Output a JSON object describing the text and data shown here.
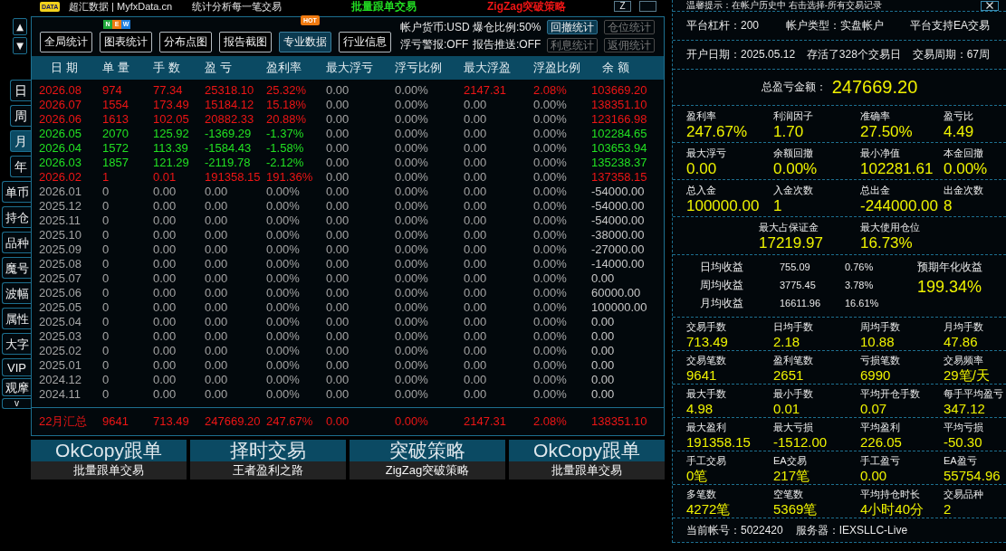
{
  "nav": {
    "scroll": [
      "▲",
      "▼"
    ],
    "periods": [
      {
        "label": "日",
        "selected": false
      },
      {
        "label": "周",
        "selected": false
      },
      {
        "label": "月",
        "selected": true
      },
      {
        "label": "年",
        "selected": false
      }
    ],
    "views": [
      "单币",
      "持仓",
      "品种",
      "魔号",
      "波幅",
      "属性",
      "大字"
    ],
    "extras": [
      "VIP",
      "观摩"
    ],
    "more": "v"
  },
  "top_strip": {
    "logo": "DATA",
    "site": "超汇数据 | MyfxData.cn",
    "tagline": "统计分析每一笔交易",
    "promos": [
      {
        "text": "批量跟单交易",
        "color": "#22dd22"
      },
      {
        "text": "ZigZag突破策略",
        "color": "#ee1515"
      }
    ],
    "buttons": [
      "Z"
    ]
  },
  "toolbar": {
    "buttons": [
      {
        "label": "全局统计",
        "selected": false
      },
      {
        "label": "图表统计",
        "selected": false,
        "badge": {
          "kind": "new",
          "letters": [
            {
              "text": "N",
              "color": "#1fa83a"
            },
            {
              "text": "E",
              "color": "#f07a10"
            },
            {
              "text": "W",
              "color": "#1e7fe0"
            }
          ]
        }
      },
      {
        "label": "分布点图",
        "selected": false
      },
      {
        "label": "报告截图",
        "selected": false
      },
      {
        "label": "专业数据",
        "selected": true,
        "badge": {
          "kind": "hot",
          "text": "HOT"
        }
      },
      {
        "label": "行业信息",
        "selected": false
      }
    ],
    "settings": [
      "帐户货币:USD",
      "爆仓比例:50%",
      "浮亏警报:OFF",
      "报告推送:OFF"
    ],
    "side_buttons": [
      {
        "label": "回撤统计",
        "disabled": false
      },
      {
        "label": "仓位统计",
        "disabled": true
      },
      {
        "label": "利息统计",
        "disabled": true
      },
      {
        "label": "返佣统计",
        "disabled": true
      }
    ]
  },
  "table": {
    "columns": [
      "日 期",
      "单 量",
      "手 数",
      "盈 亏",
      "盈利率",
      "最大浮亏",
      "浮亏比例",
      "最大浮盈",
      "浮盈比例",
      "余 额"
    ],
    "rows": [
      {
        "cells": [
          {
            "text": "2026.08",
            "color": "#ee1515"
          },
          {
            "text": "974",
            "color": "#ee1515"
          },
          {
            "text": "77.34",
            "color": "#ee1515"
          },
          {
            "text": "25318.10",
            "color": "#ee1515"
          },
          {
            "text": "25.32%",
            "color": "#ee1515"
          },
          {
            "text": "0.00",
            "color": "#a4a4a4"
          },
          {
            "text": "0.00%",
            "color": "#a4a4a4"
          },
          {
            "text": "2147.31",
            "color": "#ee1515"
          },
          {
            "text": "2.08%",
            "color": "#ee1515"
          },
          {
            "text": "103669.20",
            "color": "#ee1515"
          }
        ]
      },
      {
        "cells": [
          {
            "text": "2026.07",
            "color": "#ee1515"
          },
          {
            "text": "1554",
            "color": "#ee1515"
          },
          {
            "text": "173.49",
            "color": "#ee1515"
          },
          {
            "text": "15184.12",
            "color": "#ee1515"
          },
          {
            "text": "15.18%",
            "color": "#ee1515"
          },
          {
            "text": "0.00",
            "color": "#a4a4a4"
          },
          {
            "text": "0.00%",
            "color": "#a4a4a4"
          },
          {
            "text": "0.00",
            "color": "#a4a4a4"
          },
          {
            "text": "0.00%",
            "color": "#a4a4a4"
          },
          {
            "text": "138351.10",
            "color": "#ee1515"
          }
        ]
      },
      {
        "cells": [
          {
            "text": "2026.06",
            "color": "#ee1515"
          },
          {
            "text": "1613",
            "color": "#ee1515"
          },
          {
            "text": "102.05",
            "color": "#ee1515"
          },
          {
            "text": "20882.33",
            "color": "#ee1515"
          },
          {
            "text": "20.88%",
            "color": "#ee1515"
          },
          {
            "text": "0.00",
            "color": "#a4a4a4"
          },
          {
            "text": "0.00%",
            "color": "#a4a4a4"
          },
          {
            "text": "0.00",
            "color": "#a4a4a4"
          },
          {
            "text": "0.00%",
            "color": "#a4a4a4"
          },
          {
            "text": "123166.98",
            "color": "#ee1515"
          }
        ]
      },
      {
        "cells": [
          {
            "text": "2026.05",
            "color": "#22e022"
          },
          {
            "text": "2070",
            "color": "#22e022"
          },
          {
            "text": "125.92",
            "color": "#22e022"
          },
          {
            "text": "-1369.29",
            "color": "#22e022"
          },
          {
            "text": "-1.37%",
            "color": "#22e022"
          },
          {
            "text": "0.00",
            "color": "#a4a4a4"
          },
          {
            "text": "0.00%",
            "color": "#a4a4a4"
          },
          {
            "text": "0.00",
            "color": "#a4a4a4"
          },
          {
            "text": "0.00%",
            "color": "#a4a4a4"
          },
          {
            "text": "102284.65",
            "color": "#22e022"
          }
        ]
      },
      {
        "cells": [
          {
            "text": "2026.04",
            "color": "#22e022"
          },
          {
            "text": "1572",
            "color": "#22e022"
          },
          {
            "text": "113.39",
            "color": "#22e022"
          },
          {
            "text": "-1584.43",
            "color": "#22e022"
          },
          {
            "text": "-1.58%",
            "color": "#22e022"
          },
          {
            "text": "0.00",
            "color": "#a4a4a4"
          },
          {
            "text": "0.00%",
            "color": "#a4a4a4"
          },
          {
            "text": "0.00",
            "color": "#a4a4a4"
          },
          {
            "text": "0.00%",
            "color": "#a4a4a4"
          },
          {
            "text": "103653.94",
            "color": "#22e022"
          }
        ]
      },
      {
        "cells": [
          {
            "text": "2026.03",
            "color": "#22e022"
          },
          {
            "text": "1857",
            "color": "#22e022"
          },
          {
            "text": "121.29",
            "color": "#22e022"
          },
          {
            "text": "-2119.78",
            "color": "#22e022"
          },
          {
            "text": "-2.12%",
            "color": "#22e022"
          },
          {
            "text": "0.00",
            "color": "#a4a4a4"
          },
          {
            "text": "0.00%",
            "color": "#a4a4a4"
          },
          {
            "text": "0.00",
            "color": "#a4a4a4"
          },
          {
            "text": "0.00%",
            "color": "#a4a4a4"
          },
          {
            "text": "135238.37",
            "color": "#22e022"
          }
        ]
      },
      {
        "cells": [
          {
            "text": "2026.02",
            "color": "#ee1515"
          },
          {
            "text": "1",
            "color": "#ee1515"
          },
          {
            "text": "0.01",
            "color": "#ee1515"
          },
          {
            "text": "191358.15",
            "color": "#ee1515"
          },
          {
            "text": "191.36%",
            "color": "#ee1515"
          },
          {
            "text": "0.00",
            "color": "#a4a4a4"
          },
          {
            "text": "0.00%",
            "color": "#a4a4a4"
          },
          {
            "text": "0.00",
            "color": "#a4a4a4"
          },
          {
            "text": "0.00%",
            "color": "#a4a4a4"
          },
          {
            "text": "137358.15",
            "color": "#ee1515"
          }
        ]
      },
      {
        "cells": [
          {
            "text": "2026.01",
            "color": "#a4a4a4"
          },
          {
            "text": "0",
            "color": "#a4a4a4"
          },
          {
            "text": "0.00",
            "color": "#a4a4a4"
          },
          {
            "text": "0.00",
            "color": "#a4a4a4"
          },
          {
            "text": "0.00%",
            "color": "#a4a4a4"
          },
          {
            "text": "0.00",
            "color": "#a4a4a4"
          },
          {
            "text": "0.00%",
            "color": "#a4a4a4"
          },
          {
            "text": "0.00",
            "color": "#a4a4a4"
          },
          {
            "text": "0.00%",
            "color": "#a4a4a4"
          },
          {
            "text": "-54000.00",
            "color": "#c6c6c6"
          }
        ]
      },
      {
        "cells": [
          {
            "text": "2025.12",
            "color": "#a4a4a4"
          },
          {
            "text": "0",
            "color": "#a4a4a4"
          },
          {
            "text": "0.00",
            "color": "#a4a4a4"
          },
          {
            "text": "0.00",
            "color": "#a4a4a4"
          },
          {
            "text": "0.00%",
            "color": "#a4a4a4"
          },
          {
            "text": "0.00",
            "color": "#a4a4a4"
          },
          {
            "text": "0.00%",
            "color": "#a4a4a4"
          },
          {
            "text": "0.00",
            "color": "#a4a4a4"
          },
          {
            "text": "0.00%",
            "color": "#a4a4a4"
          },
          {
            "text": "-54000.00",
            "color": "#c6c6c6"
          }
        ]
      },
      {
        "cells": [
          {
            "text": "2025.11",
            "color": "#a4a4a4"
          },
          {
            "text": "0",
            "color": "#a4a4a4"
          },
          {
            "text": "0.00",
            "color": "#a4a4a4"
          },
          {
            "text": "0.00",
            "color": "#a4a4a4"
          },
          {
            "text": "0.00%",
            "color": "#a4a4a4"
          },
          {
            "text": "0.00",
            "color": "#a4a4a4"
          },
          {
            "text": "0.00%",
            "color": "#a4a4a4"
          },
          {
            "text": "0.00",
            "color": "#a4a4a4"
          },
          {
            "text": "0.00%",
            "color": "#a4a4a4"
          },
          {
            "text": "-54000.00",
            "color": "#c6c6c6"
          }
        ]
      },
      {
        "cells": [
          {
            "text": "2025.10",
            "color": "#a4a4a4"
          },
          {
            "text": "0",
            "color": "#a4a4a4"
          },
          {
            "text": "0.00",
            "color": "#a4a4a4"
          },
          {
            "text": "0.00",
            "color": "#a4a4a4"
          },
          {
            "text": "0.00%",
            "color": "#a4a4a4"
          },
          {
            "text": "0.00",
            "color": "#a4a4a4"
          },
          {
            "text": "0.00%",
            "color": "#a4a4a4"
          },
          {
            "text": "0.00",
            "color": "#a4a4a4"
          },
          {
            "text": "0.00%",
            "color": "#a4a4a4"
          },
          {
            "text": "-38000.00",
            "color": "#c6c6c6"
          }
        ]
      },
      {
        "cells": [
          {
            "text": "2025.09",
            "color": "#a4a4a4"
          },
          {
            "text": "0",
            "color": "#a4a4a4"
          },
          {
            "text": "0.00",
            "color": "#a4a4a4"
          },
          {
            "text": "0.00",
            "color": "#a4a4a4"
          },
          {
            "text": "0.00%",
            "color": "#a4a4a4"
          },
          {
            "text": "0.00",
            "color": "#a4a4a4"
          },
          {
            "text": "0.00%",
            "color": "#a4a4a4"
          },
          {
            "text": "0.00",
            "color": "#a4a4a4"
          },
          {
            "text": "0.00%",
            "color": "#a4a4a4"
          },
          {
            "text": "-27000.00",
            "color": "#c6c6c6"
          }
        ]
      },
      {
        "cells": [
          {
            "text": "2025.08",
            "color": "#a4a4a4"
          },
          {
            "text": "0",
            "color": "#a4a4a4"
          },
          {
            "text": "0.00",
            "color": "#a4a4a4"
          },
          {
            "text": "0.00",
            "color": "#a4a4a4"
          },
          {
            "text": "0.00%",
            "color": "#a4a4a4"
          },
          {
            "text": "0.00",
            "color": "#a4a4a4"
          },
          {
            "text": "0.00%",
            "color": "#a4a4a4"
          },
          {
            "text": "0.00",
            "color": "#a4a4a4"
          },
          {
            "text": "0.00%",
            "color": "#a4a4a4"
          },
          {
            "text": "-14000.00",
            "color": "#c6c6c6"
          }
        ]
      },
      {
        "cells": [
          {
            "text": "2025.07",
            "color": "#a4a4a4"
          },
          {
            "text": "0",
            "color": "#a4a4a4"
          },
          {
            "text": "0.00",
            "color": "#a4a4a4"
          },
          {
            "text": "0.00",
            "color": "#a4a4a4"
          },
          {
            "text": "0.00%",
            "color": "#a4a4a4"
          },
          {
            "text": "0.00",
            "color": "#a4a4a4"
          },
          {
            "text": "0.00%",
            "color": "#a4a4a4"
          },
          {
            "text": "0.00",
            "color": "#a4a4a4"
          },
          {
            "text": "0.00%",
            "color": "#a4a4a4"
          },
          {
            "text": "0.00",
            "color": "#c6c6c6"
          }
        ]
      },
      {
        "cells": [
          {
            "text": "2025.06",
            "color": "#a4a4a4"
          },
          {
            "text": "0",
            "color": "#a4a4a4"
          },
          {
            "text": "0.00",
            "color": "#a4a4a4"
          },
          {
            "text": "0.00",
            "color": "#a4a4a4"
          },
          {
            "text": "0.00%",
            "color": "#a4a4a4"
          },
          {
            "text": "0.00",
            "color": "#a4a4a4"
          },
          {
            "text": "0.00%",
            "color": "#a4a4a4"
          },
          {
            "text": "0.00",
            "color": "#a4a4a4"
          },
          {
            "text": "0.00%",
            "color": "#a4a4a4"
          },
          {
            "text": "60000.00",
            "color": "#c6c6c6"
          }
        ]
      },
      {
        "cells": [
          {
            "text": "2025.05",
            "color": "#a4a4a4"
          },
          {
            "text": "0",
            "color": "#a4a4a4"
          },
          {
            "text": "0.00",
            "color": "#a4a4a4"
          },
          {
            "text": "0.00",
            "color": "#a4a4a4"
          },
          {
            "text": "0.00%",
            "color": "#a4a4a4"
          },
          {
            "text": "0.00",
            "color": "#a4a4a4"
          },
          {
            "text": "0.00%",
            "color": "#a4a4a4"
          },
          {
            "text": "0.00",
            "color": "#a4a4a4"
          },
          {
            "text": "0.00%",
            "color": "#a4a4a4"
          },
          {
            "text": "100000.00",
            "color": "#c6c6c6"
          }
        ]
      },
      {
        "cells": [
          {
            "text": "2025.04",
            "color": "#a4a4a4"
          },
          {
            "text": "0",
            "color": "#a4a4a4"
          },
          {
            "text": "0.00",
            "color": "#a4a4a4"
          },
          {
            "text": "0.00",
            "color": "#a4a4a4"
          },
          {
            "text": "0.00%",
            "color": "#a4a4a4"
          },
          {
            "text": "0.00",
            "color": "#a4a4a4"
          },
          {
            "text": "0.00%",
            "color": "#a4a4a4"
          },
          {
            "text": "0.00",
            "color": "#a4a4a4"
          },
          {
            "text": "0.00%",
            "color": "#a4a4a4"
          },
          {
            "text": "0.00",
            "color": "#c6c6c6"
          }
        ]
      },
      {
        "cells": [
          {
            "text": "2025.03",
            "color": "#a4a4a4"
          },
          {
            "text": "0",
            "color": "#a4a4a4"
          },
          {
            "text": "0.00",
            "color": "#a4a4a4"
          },
          {
            "text": "0.00",
            "color": "#a4a4a4"
          },
          {
            "text": "0.00%",
            "color": "#a4a4a4"
          },
          {
            "text": "0.00",
            "color": "#a4a4a4"
          },
          {
            "text": "0.00%",
            "color": "#a4a4a4"
          },
          {
            "text": "0.00",
            "color": "#a4a4a4"
          },
          {
            "text": "0.00%",
            "color": "#a4a4a4"
          },
          {
            "text": "0.00",
            "color": "#c6c6c6"
          }
        ]
      },
      {
        "cells": [
          {
            "text": "2025.02",
            "color": "#a4a4a4"
          },
          {
            "text": "0",
            "color": "#a4a4a4"
          },
          {
            "text": "0.00",
            "color": "#a4a4a4"
          },
          {
            "text": "0.00",
            "color": "#a4a4a4"
          },
          {
            "text": "0.00%",
            "color": "#a4a4a4"
          },
          {
            "text": "0.00",
            "color": "#a4a4a4"
          },
          {
            "text": "0.00%",
            "color": "#a4a4a4"
          },
          {
            "text": "0.00",
            "color": "#a4a4a4"
          },
          {
            "text": "0.00%",
            "color": "#a4a4a4"
          },
          {
            "text": "0.00",
            "color": "#c6c6c6"
          }
        ]
      },
      {
        "cells": [
          {
            "text": "2025.01",
            "color": "#a4a4a4"
          },
          {
            "text": "0",
            "color": "#a4a4a4"
          },
          {
            "text": "0.00",
            "color": "#a4a4a4"
          },
          {
            "text": "0.00",
            "color": "#a4a4a4"
          },
          {
            "text": "0.00%",
            "color": "#a4a4a4"
          },
          {
            "text": "0.00",
            "color": "#a4a4a4"
          },
          {
            "text": "0.00%",
            "color": "#a4a4a4"
          },
          {
            "text": "0.00",
            "color": "#a4a4a4"
          },
          {
            "text": "0.00%",
            "color": "#a4a4a4"
          },
          {
            "text": "0.00",
            "color": "#c6c6c6"
          }
        ]
      },
      {
        "cells": [
          {
            "text": "2024.12",
            "color": "#a4a4a4"
          },
          {
            "text": "0",
            "color": "#a4a4a4"
          },
          {
            "text": "0.00",
            "color": "#a4a4a4"
          },
          {
            "text": "0.00",
            "color": "#a4a4a4"
          },
          {
            "text": "0.00%",
            "color": "#a4a4a4"
          },
          {
            "text": "0.00",
            "color": "#a4a4a4"
          },
          {
            "text": "0.00%",
            "color": "#a4a4a4"
          },
          {
            "text": "0.00",
            "color": "#a4a4a4"
          },
          {
            "text": "0.00%",
            "color": "#a4a4a4"
          },
          {
            "text": "0.00",
            "color": "#c6c6c6"
          }
        ]
      },
      {
        "cells": [
          {
            "text": "2024.11",
            "color": "#a4a4a4"
          },
          {
            "text": "0",
            "color": "#a4a4a4"
          },
          {
            "text": "0.00",
            "color": "#a4a4a4"
          },
          {
            "text": "0.00",
            "color": "#a4a4a4"
          },
          {
            "text": "0.00%",
            "color": "#a4a4a4"
          },
          {
            "text": "0.00",
            "color": "#a4a4a4"
          },
          {
            "text": "0.00%",
            "color": "#a4a4a4"
          },
          {
            "text": "0.00",
            "color": "#a4a4a4"
          },
          {
            "text": "0.00%",
            "color": "#a4a4a4"
          },
          {
            "text": "0.00",
            "color": "#c6c6c6"
          }
        ]
      }
    ],
    "summary": {
      "color": "#ee1515",
      "cells": [
        "22月汇总",
        "9641",
        "713.49",
        "247669.20",
        "247.67%",
        "0.00",
        "0.00%",
        "2147.31",
        "2.08%",
        "138351.10"
      ]
    }
  },
  "banners": [
    {
      "title": "OkCopy跟单",
      "subtitle": "批量跟单交易"
    },
    {
      "title": "择时交易",
      "subtitle": "王者盈利之路"
    },
    {
      "title": "突破策略",
      "subtitle": "ZigZag突破策略"
    },
    {
      "title": "OkCopy跟单",
      "subtitle": "批量跟单交易"
    }
  ],
  "account_panel": {
    "tip": "温馨提示：在帐户历史中 右击选择-所有交易记录",
    "sections": [
      {
        "kind": "info",
        "items": [
          "平台杠杆：200",
          "帐户类型：实盘帐户",
          "平台支持EA交易"
        ]
      },
      {
        "kind": "info",
        "items": [
          "开户日期：2025.05.12",
          "存活了328个交易日",
          "交易周期：67周"
        ]
      },
      {
        "kind": "total",
        "label": "总盈亏金额：",
        "value": "247669.20"
      },
      {
        "kind": "key_stats",
        "items": [
          {
            "label": "盈利率",
            "value": "247.67%"
          },
          {
            "label": "利润因子",
            "value": "1.70"
          },
          {
            "label": "准确率",
            "value": "27.50%"
          },
          {
            "label": "盈亏比",
            "value": "4.49"
          }
        ]
      },
      {
        "kind": "key_stats",
        "items": [
          {
            "label": "最大浮亏",
            "value": "0.00"
          },
          {
            "label": "余额回撤",
            "value": "0.00%"
          },
          {
            "label": "最小净值",
            "value": "102281.61"
          },
          {
            "label": "本金回撤",
            "value": "0.00%"
          }
        ]
      },
      {
        "kind": "key_stats",
        "items": [
          {
            "label": "总入金",
            "value": "100000.00"
          },
          {
            "label": "入金次数",
            "value": "1"
          },
          {
            "label": "总出金",
            "value": "-244000.00"
          },
          {
            "label": "出金次数",
            "value": "8"
          }
        ]
      },
      {
        "kind": "margin",
        "items": [
          {
            "label": "最大占保证金",
            "value": "17219.97"
          },
          {
            "label": "最大使用仓位",
            "value": "16.73%"
          }
        ]
      },
      {
        "kind": "averages",
        "rows": [
          {
            "label": "日均收益",
            "amount": "755.09",
            "percent": "0.76%"
          },
          {
            "label": "周均收益",
            "amount": "3775.45",
            "percent": "3.78%"
          },
          {
            "label": "月均收益",
            "amount": "16611.96",
            "percent": "16.61%"
          }
        ],
        "forecast": {
          "label": "预期年化收益",
          "value": "199.34%"
        }
      },
      {
        "kind": "stats",
        "items": [
          {
            "label": "交易手数",
            "value": "713.49"
          },
          {
            "label": "日均手数",
            "value": "2.18"
          },
          {
            "label": "周均手数",
            "value": "10.88"
          },
          {
            "label": "月均手数",
            "value": "47.86"
          }
        ]
      },
      {
        "kind": "stats",
        "items": [
          {
            "label": "交易笔数",
            "value": "9641"
          },
          {
            "label": "盈利笔数",
            "value": "2651"
          },
          {
            "label": "亏损笔数",
            "value": "6990"
          },
          {
            "label": "交易频率",
            "value": "29笔/天"
          }
        ]
      },
      {
        "kind": "stats",
        "items": [
          {
            "label": "最大手数",
            "value": "4.98"
          },
          {
            "label": "最小手数",
            "value": "0.01"
          },
          {
            "label": "平均开仓手数",
            "value": "0.07"
          },
          {
            "label": "每手平均盈亏",
            "value": "347.12"
          }
        ]
      },
      {
        "kind": "stats",
        "items": [
          {
            "label": "最大盈利",
            "value": "191358.15"
          },
          {
            "label": "最大亏损",
            "value": "-1512.00"
          },
          {
            "label": "平均盈利",
            "value": "226.05"
          },
          {
            "label": "平均亏损",
            "value": "-50.30"
          }
        ]
      },
      {
        "kind": "stats",
        "items": [
          {
            "label": "手工交易",
            "value": "0笔"
          },
          {
            "label": "EA交易",
            "value": "217笔"
          },
          {
            "label": "手工盈亏",
            "value": "0.00"
          },
          {
            "label": "EA盈亏",
            "value": "55754.96"
          }
        ]
      },
      {
        "kind": "stats",
        "items": [
          {
            "label": "多笔数",
            "value": "4272笔"
          },
          {
            "label": "空笔数",
            "value": "5369笔"
          },
          {
            "label": "平均持仓时长",
            "value": "4小时40分"
          },
          {
            "label": "交易品种",
            "value": "2"
          }
        ]
      },
      {
        "kind": "footer",
        "items": [
          "当前帐号：5022420",
          "服务器：IEXSLLC-Live"
        ]
      }
    ]
  }
}
